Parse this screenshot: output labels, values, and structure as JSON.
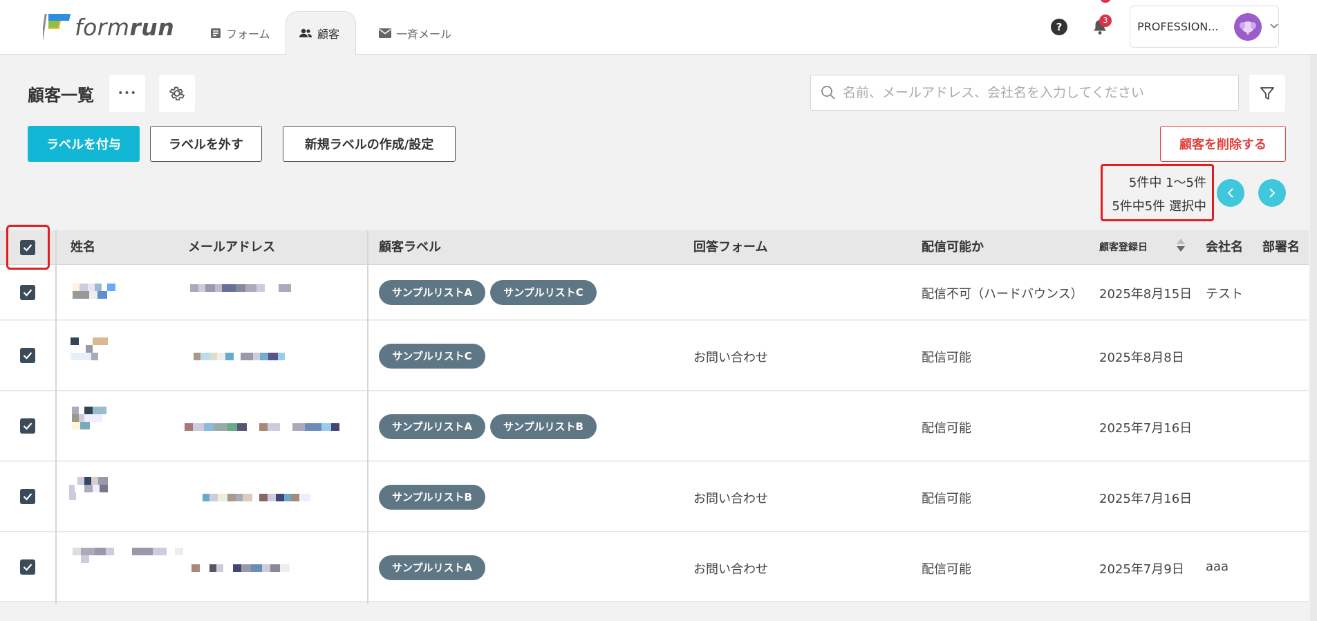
{
  "app": {
    "logo_text_plain": "form",
    "logo_text_bold": "run"
  },
  "nav": {
    "tabs": [
      {
        "label": "フォーム",
        "icon": "form-icon"
      },
      {
        "label": "顧客",
        "icon": "people-icon"
      },
      {
        "label": "一斉メール",
        "icon": "mail-icon"
      }
    ],
    "active": "顧客"
  },
  "header": {
    "help_label": "?",
    "notification_count": "3",
    "account_name": "PROFESSION..."
  },
  "page": {
    "title": "顧客一覧",
    "more_label": "•••",
    "search_placeholder": "名前、メールアドレス、会社名を入力してください"
  },
  "actions": {
    "add_label": "ラベルを付与",
    "remove_label": "ラベルを外す",
    "new_label": "新規ラベルの作成/設定",
    "delete_customers": "顧客を削除する"
  },
  "pagination": {
    "range_text": "5件中 1〜5件",
    "selected_text": "5件中5件 選択中"
  },
  "table": {
    "columns": {
      "name": "姓名",
      "email": "メールアドレス",
      "labels": "顧客ラベル",
      "form": "回答フォーム",
      "deliverable": "配信可能か",
      "registered": "顧客登録日",
      "company": "会社名",
      "department": "部署名"
    },
    "rows": [
      {
        "checked": true,
        "labels": [
          "サンプルリストA",
          "サンプルリストC"
        ],
        "form": "",
        "deliverable": "配信不可（ハードバウンス）",
        "registered": "2025年8月15日",
        "company": "テスト",
        "department": ""
      },
      {
        "checked": true,
        "labels": [
          "サンプルリストC"
        ],
        "form": "お問い合わせ",
        "deliverable": "配信可能",
        "registered": "2025年8月8日",
        "company": "",
        "department": ""
      },
      {
        "checked": true,
        "labels": [
          "サンプルリストA",
          "サンプルリストB"
        ],
        "form": "",
        "deliverable": "配信可能",
        "registered": "2025年7月16日",
        "company": "",
        "department": ""
      },
      {
        "checked": true,
        "labels": [
          "サンプルリストB"
        ],
        "form": "お問い合わせ",
        "deliverable": "配信可能",
        "registered": "2025年7月16日",
        "company": "",
        "department": ""
      },
      {
        "checked": true,
        "labels": [
          "サンプルリストA"
        ],
        "form": "お問い合わせ",
        "deliverable": "配信可能",
        "registered": "2025年7月9日",
        "company": "aaa",
        "department": ""
      }
    ]
  },
  "colors": {
    "primary": "#11b7d5",
    "danger": "#e0413e",
    "tag_bg": "#5f7684",
    "highlight": "#e01e1e",
    "avatar": "#9a5cc8"
  }
}
